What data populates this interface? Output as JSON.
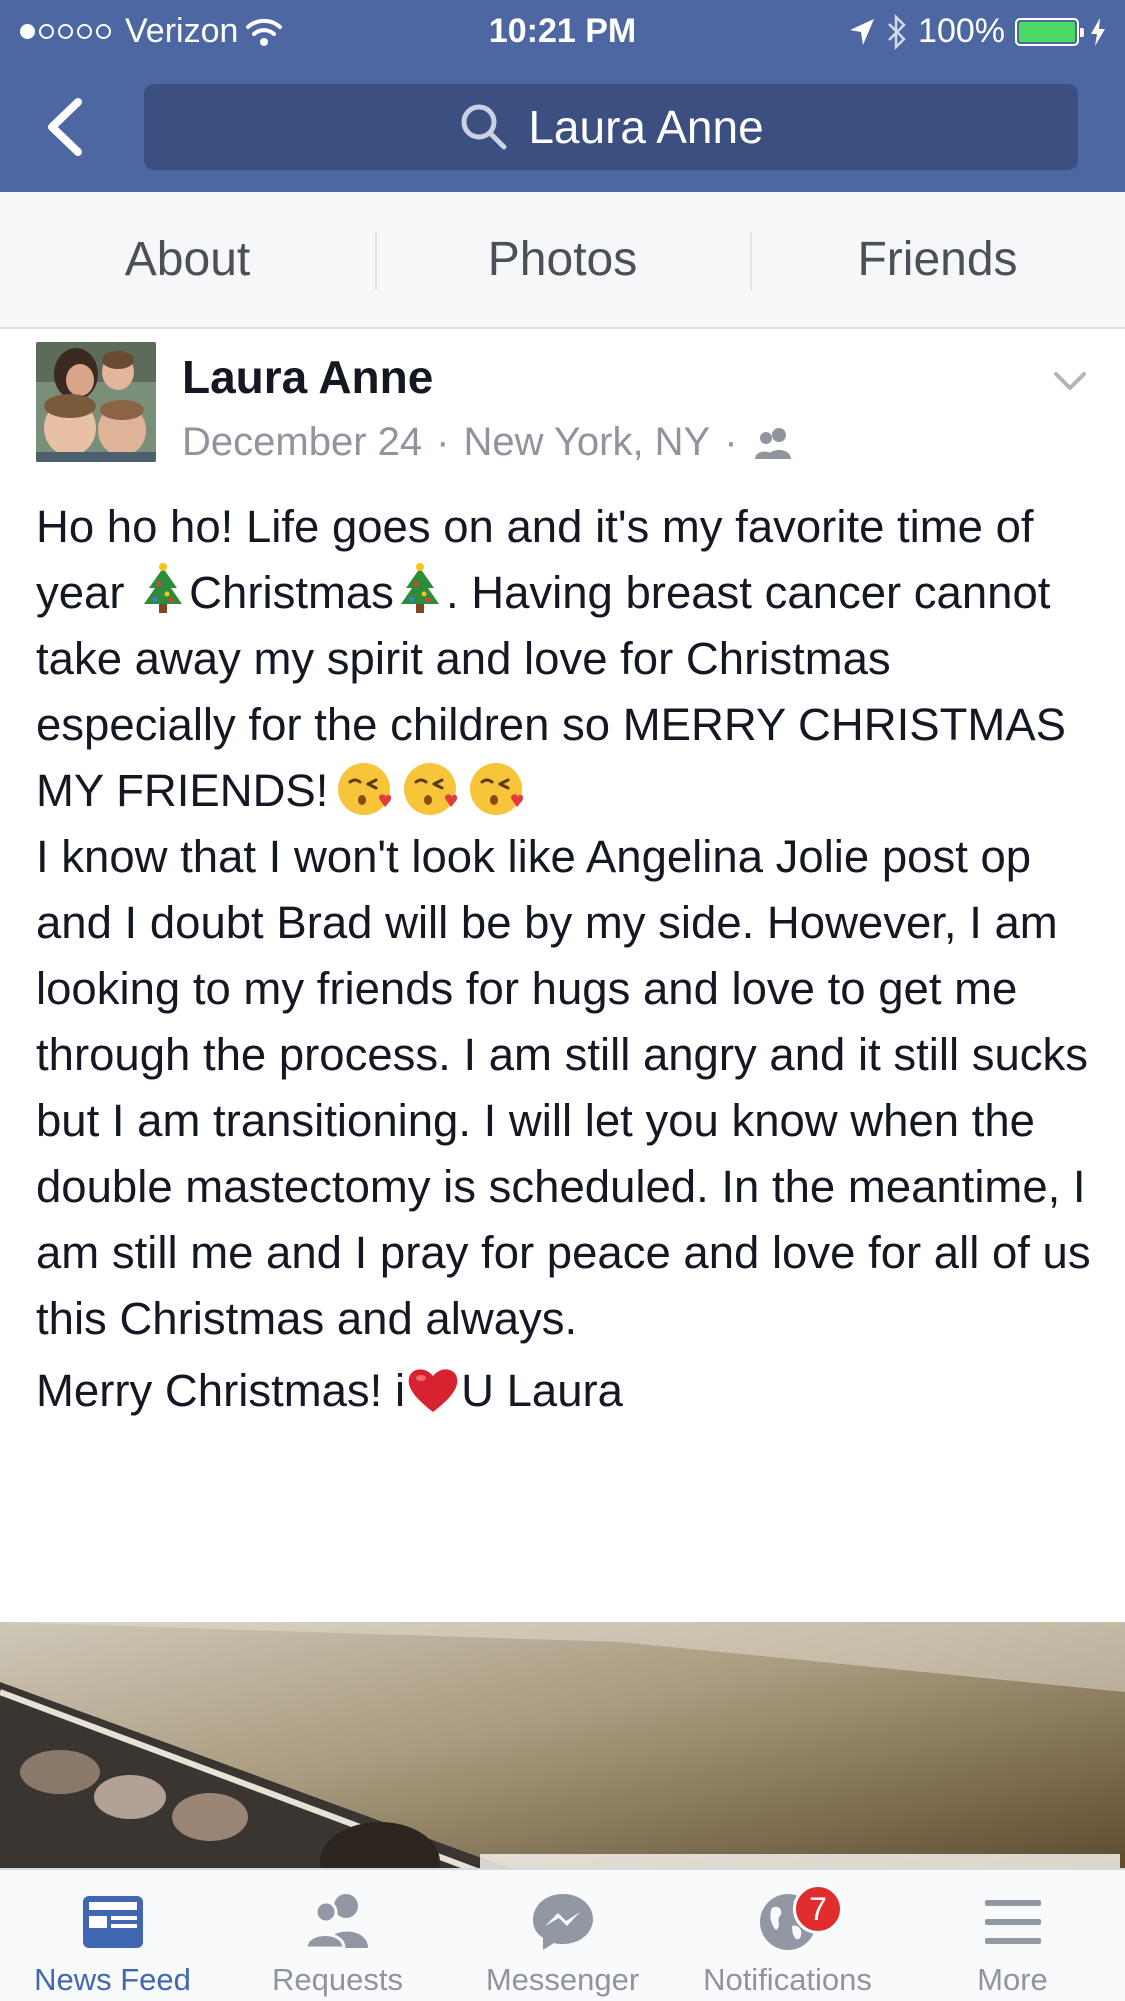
{
  "status_bar": {
    "carrier": "Verizon",
    "time": "10:21 PM",
    "battery": "100%",
    "battery_level": 1.0
  },
  "nav": {
    "search_text": "Laura Anne"
  },
  "tabs": [
    {
      "label": "About"
    },
    {
      "label": "Photos"
    },
    {
      "label": "Friends"
    }
  ],
  "post": {
    "author": "Laura Anne",
    "date": "December 24",
    "location": "New York, NY",
    "separator": "·",
    "body": {
      "t1": "Ho ho ho! Life goes on and it's my favorite time of year ",
      "t2": "Christmas",
      "t3": ". Having breast cancer cannot take away my spirit and love for Christmas especially for the children so MERRY CHRISTMAS MY FRIENDS!",
      "p2": "I know that I won't look like Angelina Jolie post op and I doubt Brad will be by my side. However, I am looking to my friends for hugs and love to get me through the process. I am still angry and it still sucks but I am transitioning. I will let you know when the double mastectomy is scheduled. In the meantime, I am still me and I pray for peace and love for all of us this Christmas and always.",
      "p3a": "Merry Christmas! i",
      "p3b": "U Laura"
    }
  },
  "bottom_nav": [
    {
      "label": "News Feed",
      "icon": "news-feed-icon",
      "active": true
    },
    {
      "label": "Requests",
      "icon": "friend-requests-icon"
    },
    {
      "label": "Messenger",
      "icon": "messenger-icon"
    },
    {
      "label": "Notifications",
      "icon": "globe-icon",
      "badge": "7"
    },
    {
      "label": "More",
      "icon": "menu-icon"
    }
  ],
  "colors": {
    "nav_blue": "#4c67a1",
    "search_blue": "#3b4f80",
    "active_blue": "#4267b2",
    "badge_red": "#e02e2e"
  }
}
